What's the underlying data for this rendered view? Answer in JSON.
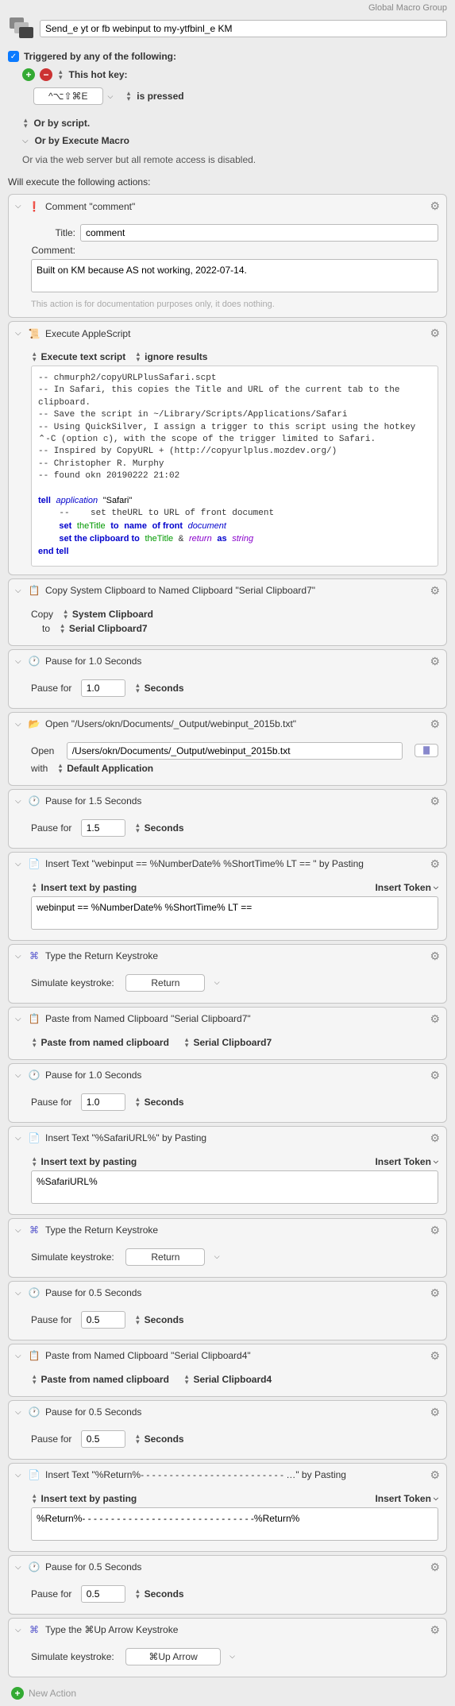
{
  "header": {
    "group": "Global Macro Group"
  },
  "macro": {
    "name": "Send_e yt or fb webinput to my-ytfbinl_e KM"
  },
  "trigger": {
    "label": "Triggered by any of the following:",
    "hotkey_label": "This hot key:",
    "hotkey": "^⌥⇧⌘E",
    "pressed": "is pressed",
    "script": "Or by script.",
    "execute_macro": "Or by Execute Macro",
    "webserver": "Or via the web server but all remote access is disabled."
  },
  "exec_label": "Will execute the following actions:",
  "actions": {
    "comment": {
      "title": "Comment \"comment\"",
      "title_label": "Title:",
      "title_value": "comment",
      "comment_label": "Comment:",
      "comment_value": "Built on KM because AS not working, 2022-07-14.",
      "hint": "This action is for documentation purposes only, it does nothing."
    },
    "applescript": {
      "title": "Execute AppleScript",
      "exec_text": "Execute text script",
      "ignore": "ignore results"
    },
    "copy_clip": {
      "title": "Copy System Clipboard to Named Clipboard \"Serial Clipboard7\"",
      "copy_label": "Copy",
      "copy_value": "System Clipboard",
      "to_label": "to",
      "to_value": "Serial Clipboard7"
    },
    "pause1": {
      "title": "Pause for 1.0 Seconds",
      "label": "Pause for",
      "value": "1.0",
      "unit": "Seconds"
    },
    "open": {
      "title": "Open \"/Users/okn/Documents/_Output/webinput_2015b.txt\"",
      "open_label": "Open",
      "path": "/Users/okn/Documents/_Output/webinput_2015b.txt",
      "with_label": "with",
      "with_value": "Default Application"
    },
    "pause2": {
      "title": "Pause for 1.5 Seconds",
      "label": "Pause for",
      "value": "1.5",
      "unit": "Seconds"
    },
    "insert1": {
      "title": "Insert Text \"webinput == %NumberDate% %ShortTime% LT == \" by Pasting",
      "method": "Insert text by pasting",
      "token": "Insert Token",
      "text": "webinput == %NumberDate% %ShortTime% LT =="
    },
    "return1": {
      "title": "Type the Return Keystroke",
      "label": "Simulate keystroke:",
      "key": "Return"
    },
    "paste1": {
      "title": "Paste from Named Clipboard \"Serial Clipboard7\"",
      "method": "Paste from named clipboard",
      "clip": "Serial Clipboard7"
    },
    "pause3": {
      "title": "Pause for 1.0 Seconds",
      "label": "Pause for",
      "value": "1.0",
      "unit": "Seconds"
    },
    "insert2": {
      "title": "Insert Text \"%SafariURL%\" by Pasting",
      "method": "Insert text by pasting",
      "token": "Insert Token",
      "text": "%SafariURL%"
    },
    "return2": {
      "title": "Type the Return Keystroke",
      "label": "Simulate keystroke:",
      "key": "Return"
    },
    "pause4": {
      "title": "Pause for 0.5 Seconds",
      "label": "Pause for",
      "value": "0.5",
      "unit": "Seconds"
    },
    "paste2": {
      "title": "Paste from Named Clipboard \"Serial Clipboard4\"",
      "method": "Paste from named clipboard",
      "clip": "Serial Clipboard4"
    },
    "pause5": {
      "title": "Pause for 0.5 Seconds",
      "label": "Pause for",
      "value": "0.5",
      "unit": "Seconds"
    },
    "insert3": {
      "title": "Insert Text \"%Return%- - - - - - - - - - - - - - - - - - - - - - - - - …\" by Pasting",
      "method": "Insert text by pasting",
      "token": "Insert Token",
      "text": "%Return%- - - - - - - - - - - - - - - - - - - - - - - - - - - - - -%Return%"
    },
    "pause6": {
      "title": "Pause for 0.5 Seconds",
      "label": "Pause for",
      "value": "0.5",
      "unit": "Seconds"
    },
    "uparrow": {
      "title": "Type the ⌘Up Arrow Keystroke",
      "label": "Simulate keystroke:",
      "key": "⌘Up Arrow"
    }
  },
  "new_action": "New Action"
}
